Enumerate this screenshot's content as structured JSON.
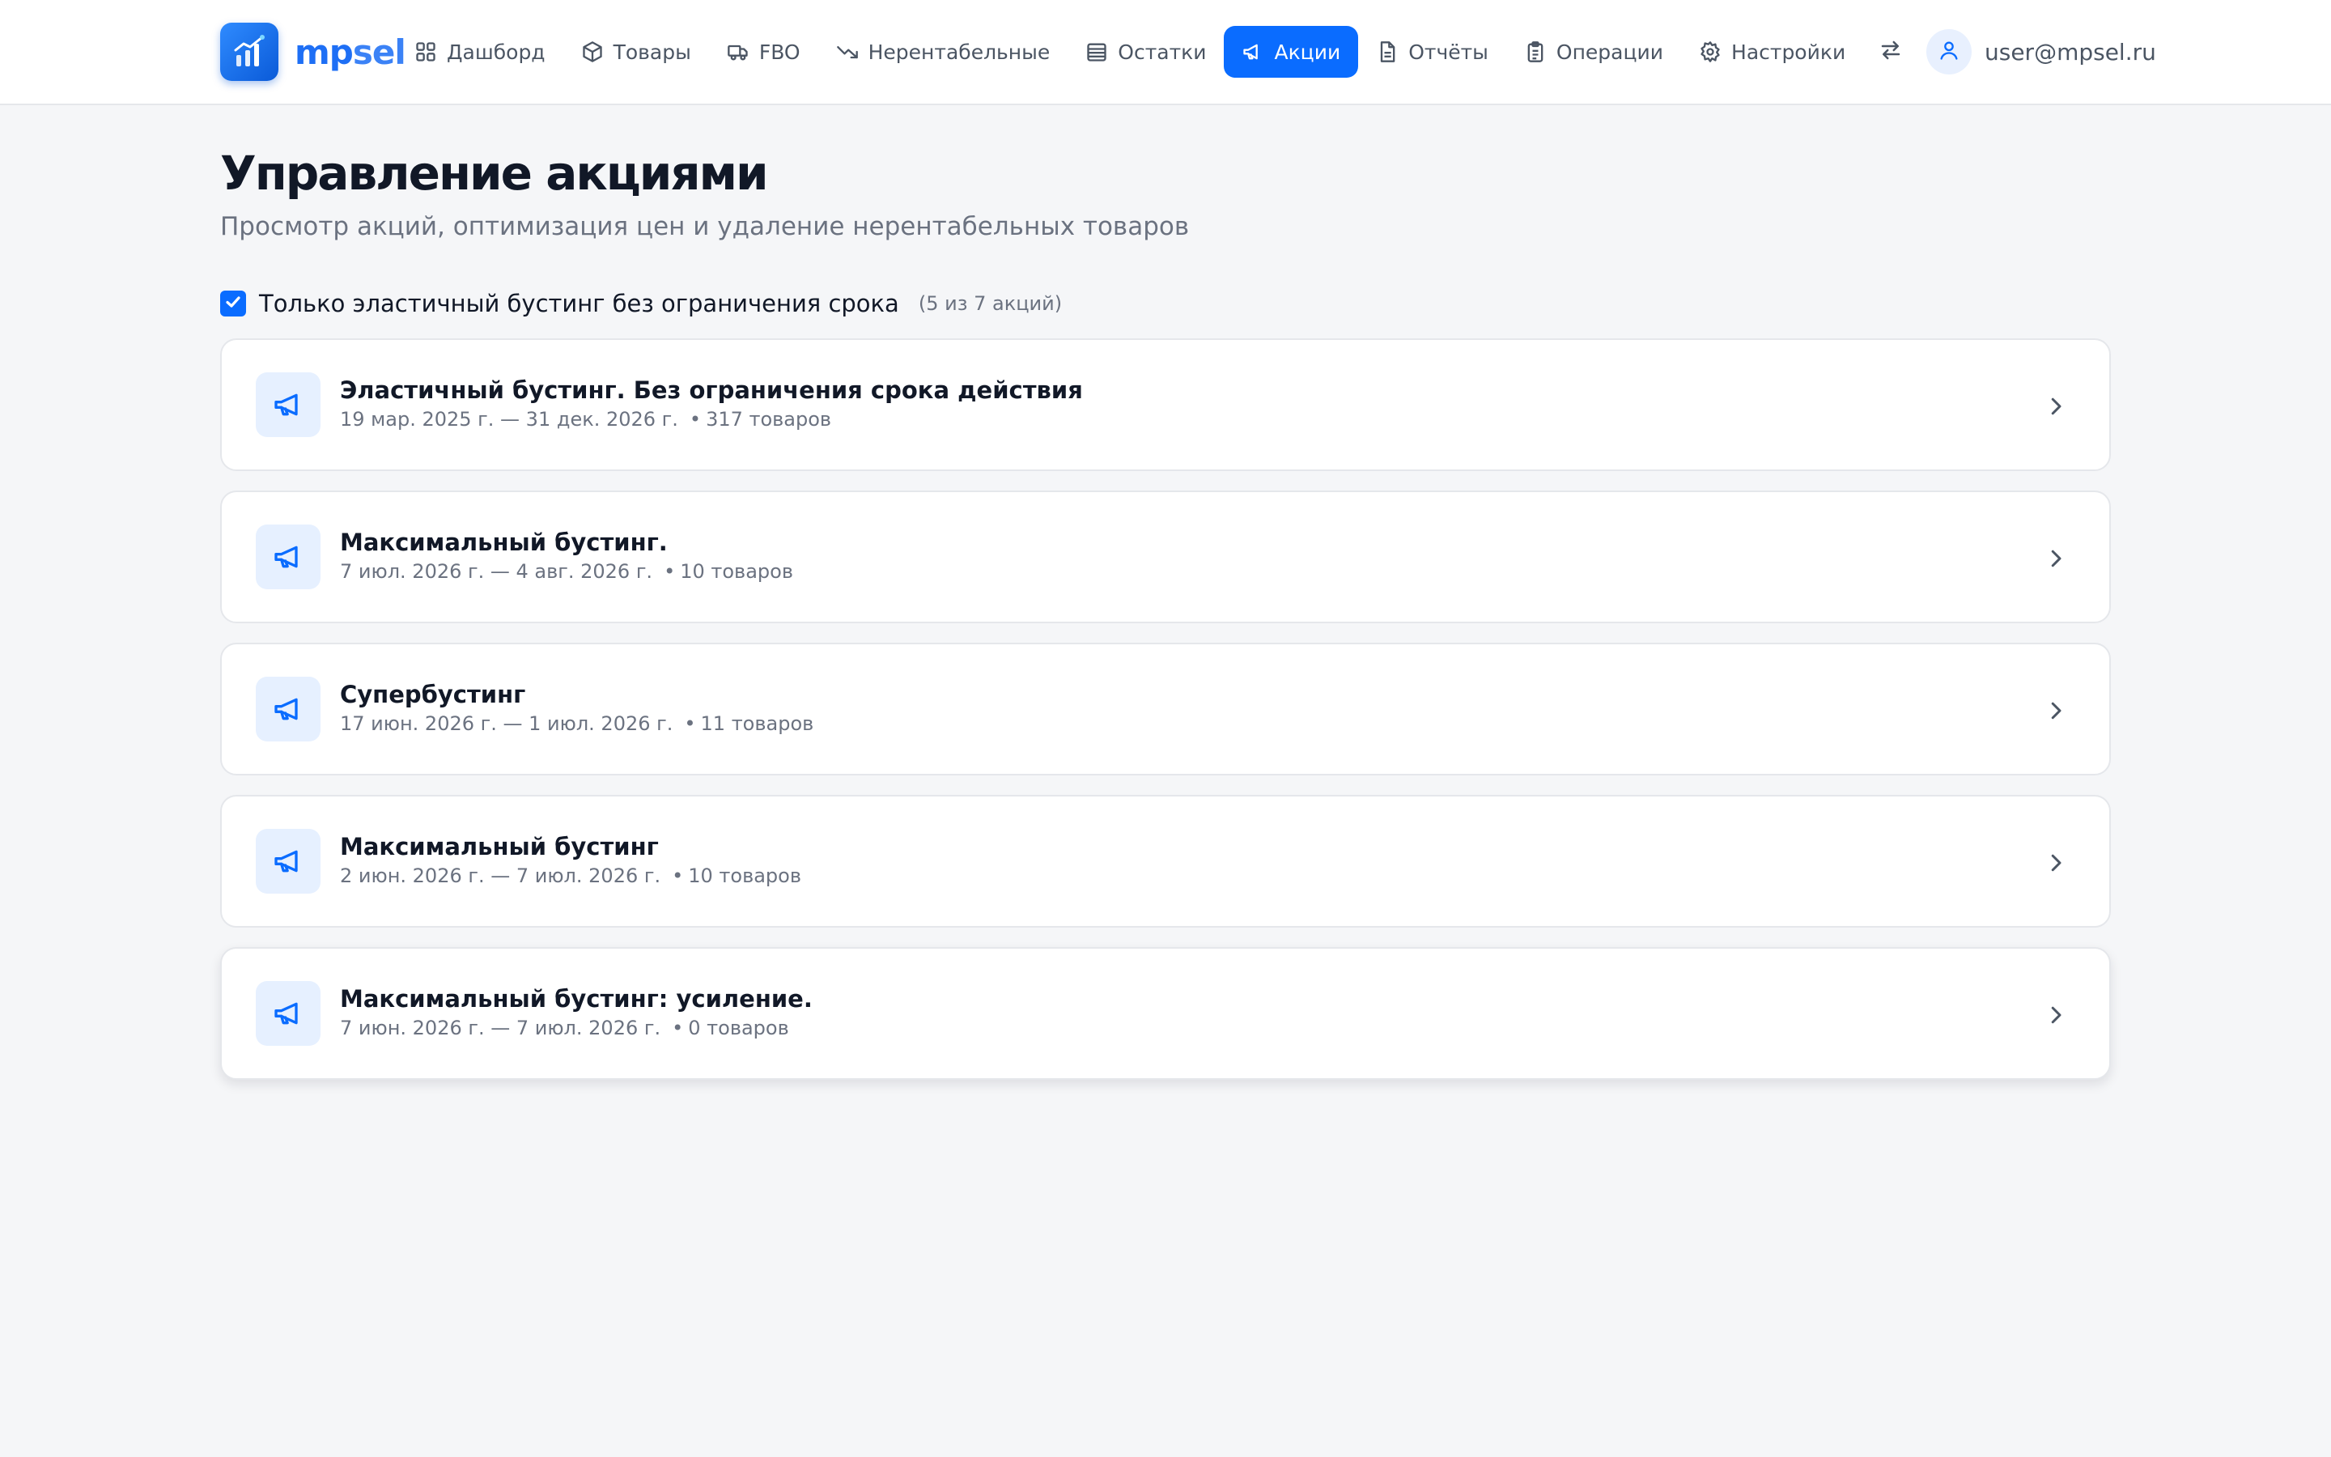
{
  "app": {
    "brand_mp": "mp",
    "brand_sel": "sel"
  },
  "nav": {
    "items": [
      {
        "label": "Дашборд",
        "icon": "dashboard-icon"
      },
      {
        "label": "Товары",
        "icon": "box-icon"
      },
      {
        "label": "FBO",
        "icon": "truck-icon"
      },
      {
        "label": "Нерентабельные",
        "icon": "trending-down-icon"
      },
      {
        "label": "Остатки",
        "icon": "archive-icon"
      },
      {
        "label": "Акции",
        "icon": "megaphone-icon",
        "active": true
      },
      {
        "label": "Отчёты",
        "icon": "document-icon"
      },
      {
        "label": "Операции",
        "icon": "clipboard-icon"
      },
      {
        "label": "Настройки",
        "icon": "gear-icon"
      }
    ],
    "swap_icon": "arrows-swap-icon",
    "user_email": "user@mpsel.ru",
    "user_icon": "user-icon"
  },
  "header": {
    "title": "Управление акциями",
    "subtitle": "Просмотр акций, оптимизация цен и удаление нерентабельных товаров"
  },
  "filter": {
    "checked": true,
    "label": "Только эластичный бустинг без ограничения срока",
    "count": "(5 из 7 акций)"
  },
  "promos": [
    {
      "title": "Эластичный бустинг. Без ограничения срока действия",
      "dates": "19 мар. 2025 г. — 31 дек. 2026 г.",
      "items": "317 товаров"
    },
    {
      "title": "Максимальный бустинг.",
      "dates": "7 июл. 2026 г. — 4 авг. 2026 г.",
      "items": "10 товаров"
    },
    {
      "title": "Супербустинг",
      "dates": "17 июн. 2026 г. — 1 июл. 2026 г.",
      "items": "11 товаров"
    },
    {
      "title": "Максимальный бустинг",
      "dates": "2 июн. 2026 г. — 7 июл. 2026 г.",
      "items": "10 товаров"
    },
    {
      "title": "Максимальный бустинг: усиление.",
      "dates": "7 июн. 2026 г. — 7 июл. 2026 г.",
      "items": "0 товаров"
    }
  ],
  "colors": {
    "accent": "#0a6cff",
    "background": "#f5f6f8",
    "icon_tile": "#e6f0ff",
    "muted_text": "#6b7280"
  }
}
